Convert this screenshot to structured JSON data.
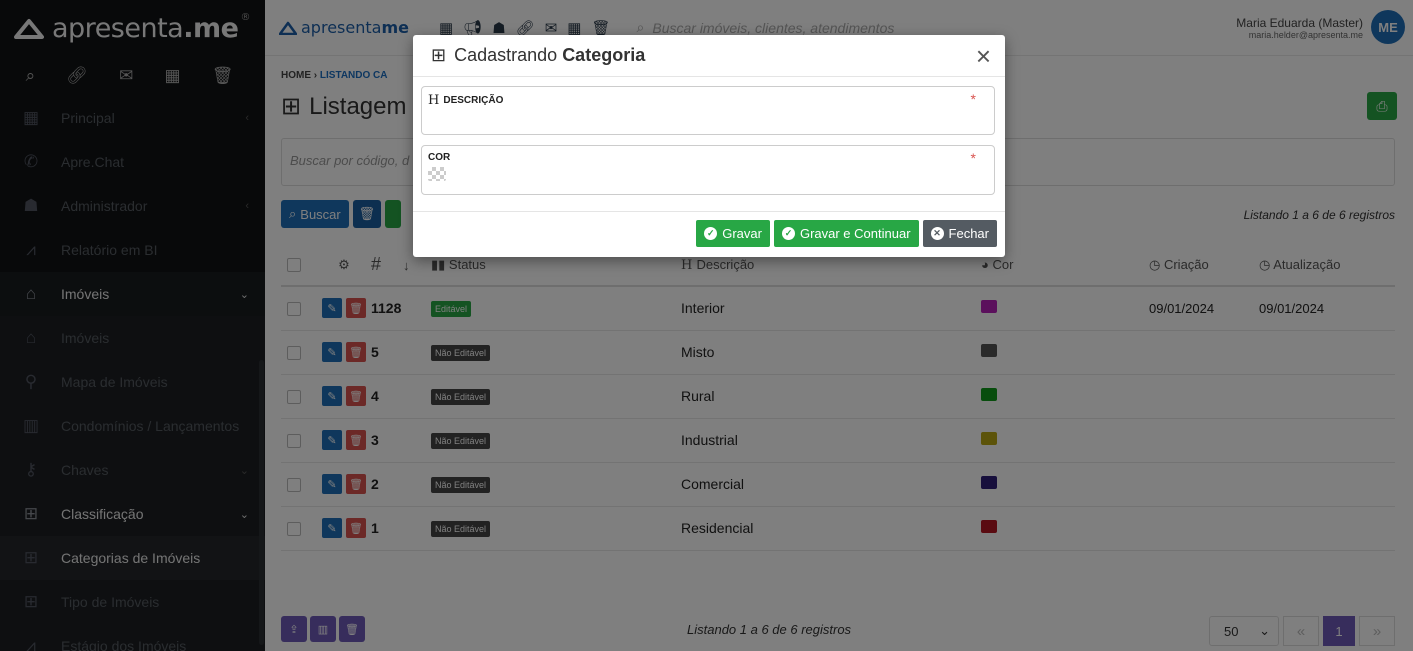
{
  "brand": {
    "name_prefix": "apresenta",
    "name_suffix": ".me",
    "reg": "®"
  },
  "sidebar": {
    "tools": [
      "search-icon",
      "link-icon",
      "mail-icon",
      "calendar-icon",
      "trash-icon"
    ],
    "items": [
      {
        "label": "Principal",
        "icon": "grid-icon",
        "chevron": "‹"
      },
      {
        "label": "Apre.Chat",
        "icon": "whatsapp-icon",
        "chevron": ""
      },
      {
        "label": "Administrador",
        "icon": "users-icon",
        "chevron": "‹"
      },
      {
        "label": "Relatório em BI",
        "icon": "chart-icon",
        "chevron": ""
      },
      {
        "label": "Imóveis",
        "icon": "home-icon",
        "chevron": "⌄"
      },
      {
        "label": "Imóveis",
        "icon": "home-icon",
        "chevron": ""
      },
      {
        "label": "Mapa de Imóveis",
        "icon": "map-pin-icon",
        "chevron": ""
      },
      {
        "label": "Condomínios / Lançamentos",
        "icon": "building-icon",
        "chevron": ""
      },
      {
        "label": "Chaves",
        "icon": "key-icon",
        "chevron": "⌄"
      },
      {
        "label": "Classificação",
        "icon": "sitemap-icon",
        "chevron": "⌄"
      },
      {
        "label": "Categorias de Imóveis",
        "icon": "sitemap-icon",
        "chevron": ""
      },
      {
        "label": "Tipo de Imóveis",
        "icon": "sitemap-icon",
        "chevron": ""
      },
      {
        "label": "Estágio dos Imóveis",
        "icon": "chart-icon",
        "chevron": ""
      }
    ]
  },
  "topbar": {
    "brand_prefix": "apresenta",
    "brand_suffix": "me",
    "search_placeholder": "Buscar imóveis, clientes, atendimentos",
    "user_name": "Maria Eduarda (Master)",
    "user_email": "maria.helder@apresenta.me",
    "avatar_initials": "ME"
  },
  "main": {
    "breadcrumb_home": "HOME",
    "breadcrumb_sep": "›",
    "breadcrumb_current": "LISTANDO CA",
    "title": "Listagem",
    "search_placeholder": "Buscar por código, d",
    "search_button": "Buscar",
    "listing_text": "Listando 1 a 6 de 6 registros",
    "columns": {
      "id": "#",
      "status": "Status",
      "descricao": "Descrição",
      "cor": "Cor",
      "criacao": "Criação",
      "atualizacao": "Atualização"
    },
    "rows": [
      {
        "id": "1128",
        "status": "Editável",
        "editable": true,
        "descricao": "Interior",
        "cor": "#b620b8",
        "criacao": "09/01/2024",
        "atualizacao": "09/01/2024"
      },
      {
        "id": "5",
        "status": "Não Editável",
        "editable": false,
        "descricao": "Misto",
        "cor": "#555555",
        "criacao": "",
        "atualizacao": ""
      },
      {
        "id": "4",
        "status": "Não Editável",
        "editable": false,
        "descricao": "Rural",
        "cor": "#119a1a",
        "criacao": "",
        "atualizacao": ""
      },
      {
        "id": "3",
        "status": "Não Editável",
        "editable": false,
        "descricao": "Industrial",
        "cor": "#b8a612",
        "criacao": "",
        "atualizacao": ""
      },
      {
        "id": "2",
        "status": "Não Editável",
        "editable": false,
        "descricao": "Comercial",
        "cor": "#2e1f78",
        "criacao": "",
        "atualizacao": ""
      },
      {
        "id": "1",
        "status": "Não Editável",
        "editable": false,
        "descricao": "Residencial",
        "cor": "#b51622",
        "criacao": "",
        "atualizacao": ""
      }
    ],
    "per_page": "50",
    "current_page": "1"
  },
  "modal": {
    "title_prefix": "Cadastrando",
    "title_bold": "Categoria",
    "close": "×",
    "field_descricao_label": "DESCRIÇÃO",
    "field_cor_label": "COR",
    "required_mark": "*",
    "btn_gravar": "Gravar",
    "btn_gravar_continuar": "Gravar e Continuar",
    "btn_fechar": "Fechar"
  },
  "colors": {
    "primary": "#1f6fb8",
    "success": "#28a745",
    "danger": "#d9534f",
    "purple": "#6f5ab8"
  }
}
